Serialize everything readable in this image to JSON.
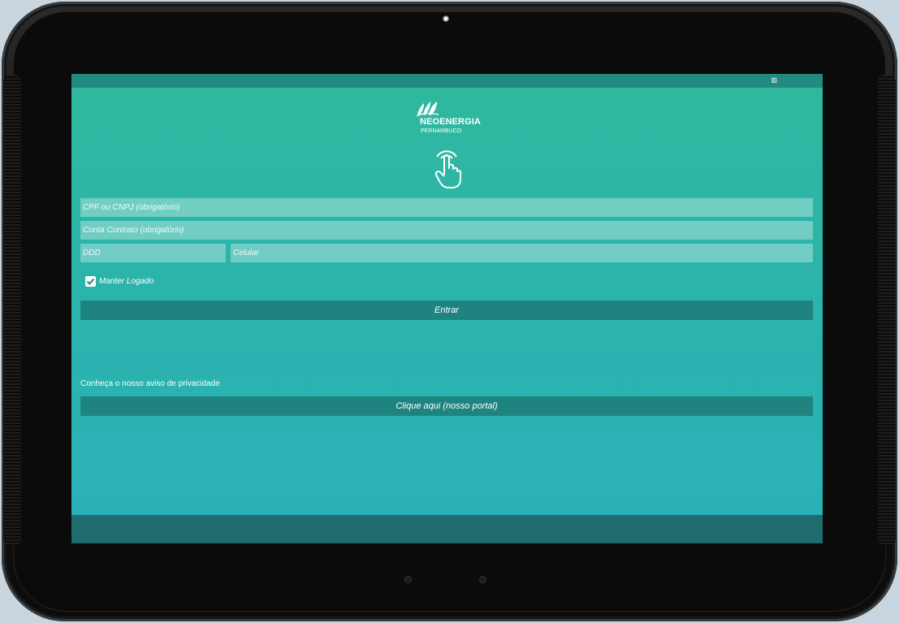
{
  "status_bar": {
    "icon": "notification-icon"
  },
  "logo": {
    "name": "NEOENERGIA",
    "sub": "PERNAMBUCO"
  },
  "form": {
    "cpf_placeholder": "CPF ou CNPJ (obrigatório)",
    "conta_placeholder": "Conta Contrato (obrigatório)",
    "ddd_placeholder": "DDD",
    "celular_placeholder": "Celular",
    "keep_logged_label": "Manter Logado",
    "keep_logged_checked": true,
    "login_button": "Entrar"
  },
  "privacy": {
    "text": "Conheça o nosso aviso de privacidade",
    "button": "Clique aqui (nosso portal)"
  },
  "colors": {
    "gradient_top": "#2fb99d",
    "gradient_bottom": "#2ab1b9",
    "button_bg": "#1f8480",
    "nav_bar": "#1e6c6d"
  }
}
